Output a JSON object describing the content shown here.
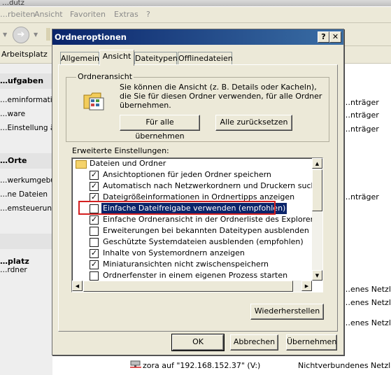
{
  "background": {
    "title_fragment": "…dutz",
    "menu": [
      "…rbeiten",
      "Ansicht",
      "Favoriten",
      "Extras",
      "?"
    ],
    "address_text": "Arbeitsplatz",
    "sections": [
      {
        "title": "…ufgaben",
        "links": [
          "…eminformatione",
          "…ware",
          "…Einstellung änd"
        ]
      },
      {
        "title": "…Orte",
        "links": [
          "…werkumgebung",
          "…ne Dateien",
          "…emsteuerung"
        ]
      },
      {
        "title": "",
        "links": []
      }
    ],
    "details": {
      "title": "…platz",
      "sub": "…rdner"
    },
    "right_column": [
      "…nträger",
      "…nträger",
      "…nträger",
      "…nträger",
      "…enes Netzlaufw",
      "…enes Netzlaufw",
      "…enes Netzlaufw"
    ],
    "bottom_row": {
      "name": "zora auf \"192.168.152.37\" (V:)",
      "type": "Nichtverbundenes Netzlaufw"
    }
  },
  "dialog": {
    "title": "Ordneroptionen",
    "help_btn": "?",
    "close_btn": "✕",
    "tabs": [
      "Allgemein",
      "Ansicht",
      "Dateitypen",
      "Offlinedateien"
    ],
    "active_tab": "Ansicht",
    "folder_view": {
      "legend": "Ordneransicht",
      "description": "Sie können die Ansicht (z. B. Details oder Kacheln), die Sie für diesen Ordner verwenden, für alle Ordner übernehmen.",
      "apply_all": "Für alle übernehmen",
      "reset_all": "Alle zurücksetzen"
    },
    "advanced_label": "Erweiterte Einstellungen:",
    "list_root": "Dateien und Ordner",
    "settings": [
      {
        "label": "Ansichtoptionen für jeden Ordner speichern",
        "checked": true
      },
      {
        "label": "Automatisch nach Netzwerkordnern und Druckern suchen",
        "checked": true
      },
      {
        "label": "Dateigrößeinformationen in Ordnertipps anzeigen",
        "checked": true
      },
      {
        "label": "Einfache Dateifreigabe verwenden (empfohlen)",
        "checked": false,
        "selected": true
      },
      {
        "label": "Einfache Ordneransicht in der Ordnerliste des Explorers anzeigen",
        "checked": true
      },
      {
        "label": "Erweiterungen bei bekannten Dateitypen ausblenden",
        "checked": false
      },
      {
        "label": "Geschützte Systemdateien ausblenden (empfohlen)",
        "checked": false
      },
      {
        "label": "Inhalte von Systemordnern anzeigen",
        "checked": true
      },
      {
        "label": "Miniaturansichten nicht zwischenspeichern",
        "checked": true
      },
      {
        "label": "Ordnerfenster in einem eigenen Prozess starten",
        "checked": false
      }
    ],
    "restore_btn": "Wiederherstellen",
    "ok_btn": "OK",
    "cancel_btn": "Abbrechen",
    "apply_btn": "Übernehmen",
    "highlight_color": "#d42020",
    "selection_color": "#0a246a"
  }
}
